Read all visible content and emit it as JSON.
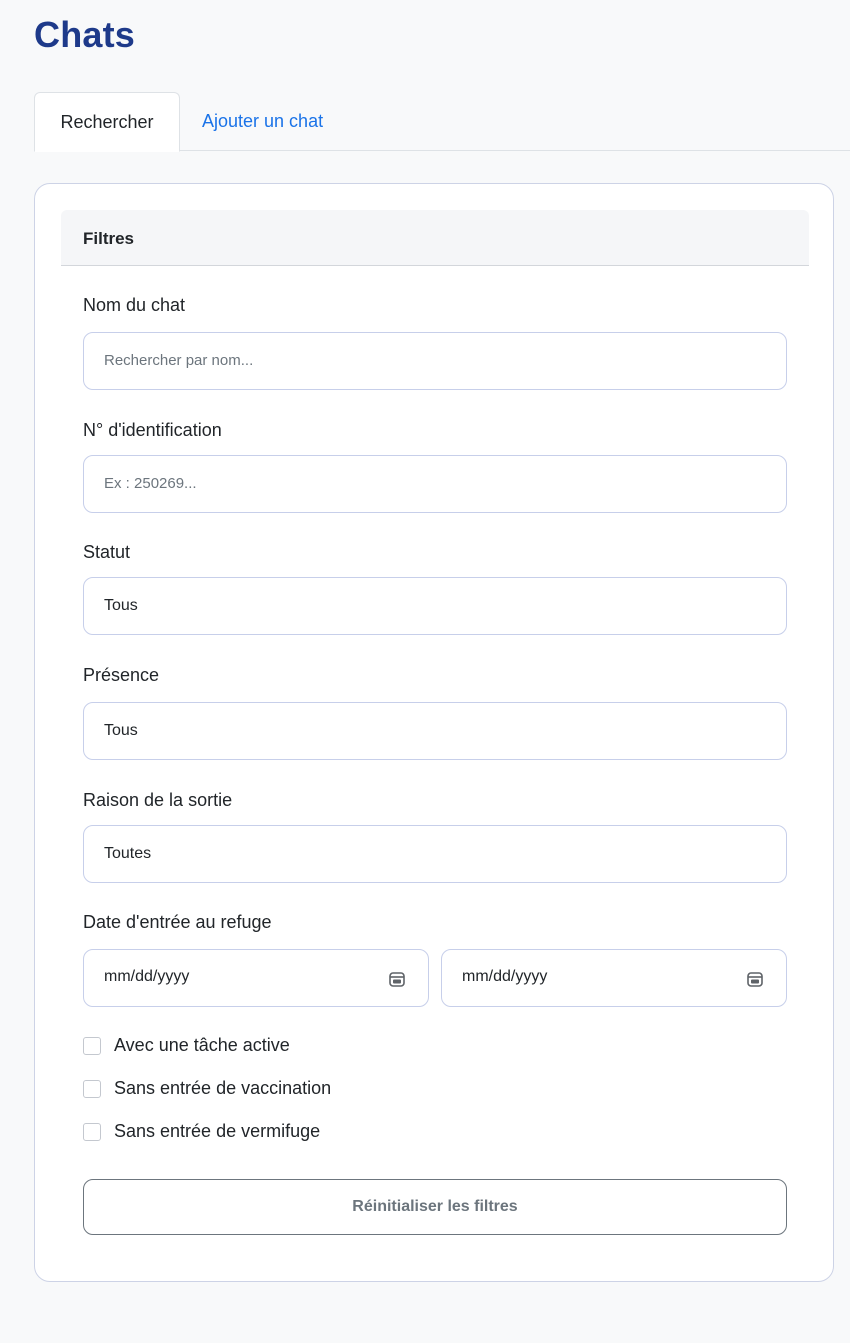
{
  "page": {
    "title": "Chats"
  },
  "tabs": [
    {
      "label": "Rechercher",
      "active": true
    },
    {
      "label": "Ajouter un chat",
      "active": false
    }
  ],
  "filters": {
    "header": "Filtres",
    "name": {
      "label": "Nom du chat",
      "placeholder": "Rechercher par nom...",
      "value": ""
    },
    "id": {
      "label": "N° d'identification",
      "placeholder": "Ex : 250269...",
      "value": ""
    },
    "status": {
      "label": "Statut",
      "selected": "Tous"
    },
    "presence": {
      "label": "Présence",
      "selected": "Tous"
    },
    "exit_reason": {
      "label": "Raison de la sortie",
      "selected": "Toutes"
    },
    "entry_date": {
      "label": "Date d'entrée au refuge",
      "from_placeholder": "mm/dd/yyyy",
      "to_placeholder": "mm/dd/yyyy"
    },
    "checkboxes": [
      {
        "label": "Avec une tâche active",
        "checked": false
      },
      {
        "label": "Sans entrée de vaccination",
        "checked": false
      },
      {
        "label": "Sans entrée de vermifuge",
        "checked": false
      }
    ],
    "reset_label": "Réinitialiser les filtres"
  },
  "icons": {
    "date_picker": "calendar-icon"
  },
  "colors": {
    "title": "#1e3a8a",
    "link": "#1a73e8",
    "field_border": "#c7cfea"
  }
}
